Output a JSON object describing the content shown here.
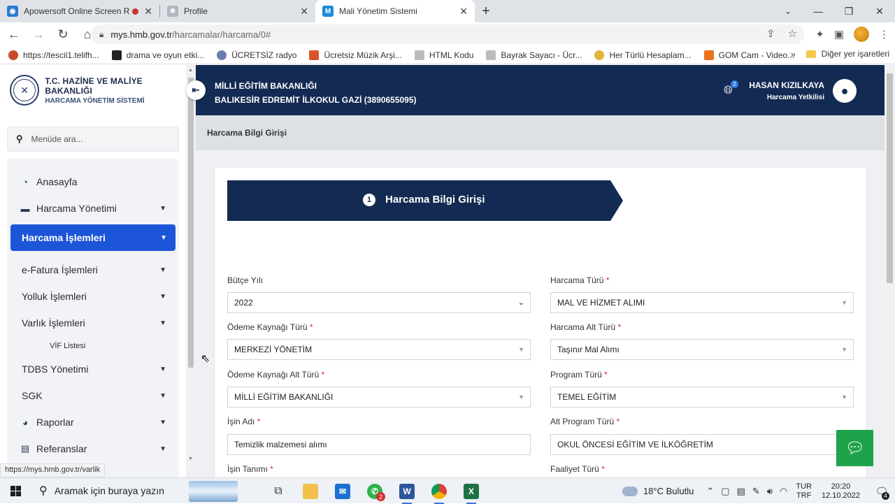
{
  "browser": {
    "tabs": [
      {
        "title": "Apowersoft Online Screen Re",
        "icon": "apowersoft-icon",
        "active": false
      },
      {
        "title": "Profile",
        "icon": "profile-icon",
        "active": false
      },
      {
        "title": "Mali Yönetim Sistemi",
        "icon": "mys-icon",
        "active": true
      }
    ],
    "url_host": "mys.hmb.gov.tr",
    "url_path": "/harcamalar/harcama/0#",
    "bookmarks": [
      "https://tescil1.telifh...",
      "drama ve oyun etki...",
      "ÜCRETSİZ radyo",
      "Ücretsiz Müzik Arşi...",
      "HTML Kodu",
      "Bayrak Sayacı - Ücr...",
      "Her Türlü Hesaplam...",
      "GOM Cam - Video..."
    ],
    "other_bookmarks": "Diğer yer işaretleri",
    "status_url": "https://mys.hmb.gov.tr/varlik"
  },
  "sidebar": {
    "logo_line1": "T.C. HAZİNE VE MALİYE BAKANLIĞI",
    "logo_line2": "HARCAMA YÖNETİM SİSTEMİ",
    "search_placeholder": "Menüde ara...",
    "items": [
      {
        "label": "Anasayfa",
        "icon": "dashboard-icon"
      },
      {
        "label": "Harcama Yönetimi",
        "icon": "card-icon"
      },
      {
        "label": "Harcama İşlemleri",
        "active": true
      },
      {
        "label": "e-Fatura İşlemleri"
      },
      {
        "label": "Yolluk İşlemleri"
      },
      {
        "label": "Varlık İşlemleri"
      },
      {
        "label": "VİF Listesi"
      },
      {
        "label": "TDBS Yönetimi"
      },
      {
        "label": "SGK"
      },
      {
        "label": "Raporlar",
        "icon": "pie-chart-icon"
      },
      {
        "label": "Referanslar",
        "icon": "book-icon"
      }
    ]
  },
  "header": {
    "org_line1": "MİLLİ EĞİTİM BAKANLIĞI",
    "org_line2": "BALIKESİR EDREMİT İLKOKUL GAZİ (3890655095)",
    "notification_count": "2",
    "user_name": "HASAN KIZILKAYA",
    "user_role": "Harcama Yetkilisi"
  },
  "page": {
    "breadcrumb": "Harcama Bilgi Girişi",
    "step_number": "1",
    "step_title": "Harcama Bilgi Girişi"
  },
  "form": {
    "butce_yili": {
      "label": "Bütçe Yılı",
      "value": "2022"
    },
    "harcama_turu": {
      "label": "Harcama Türü",
      "value": "MAL VE HİZMET ALIMI"
    },
    "odeme_kaynagi_turu": {
      "label": "Ödeme Kaynağı Türü",
      "value": "MERKEZİ YÖNETİM"
    },
    "harcama_alt_turu": {
      "label": "Harcama Alt Türü",
      "value": "Taşınır Mal Alımı"
    },
    "odeme_kaynagi_alt_turu": {
      "label": "Ödeme Kaynağı Alt Türü",
      "value": "MİLLİ EĞİTİM BAKANLIĞI"
    },
    "program_turu": {
      "label": "Program Türü",
      "value": "TEMEL EĞİTİM"
    },
    "isin_adi": {
      "label": "İşin Adı",
      "value": "Temizlik malzemesi alımı"
    },
    "alt_program_turu": {
      "label": "Alt Program Türü",
      "value": "OKUL ÖNCESİ EĞİTİM VE İLKÖĞRETİM"
    },
    "isin_tanimi": {
      "label": "İşin Tanımı"
    },
    "faaliyet_turu": {
      "label": "Faaliyet Türü"
    },
    "required_mark": "*"
  },
  "taskbar": {
    "search_placeholder": "Aramak için buraya yazın",
    "weather": "18°C  Bulutlu",
    "lang1": "TUR",
    "lang2": "TRF",
    "time": "20:20",
    "date": "12.10.2022",
    "notif_count": "4",
    "whatsapp_badge": "2"
  },
  "colors": {
    "navy": "#132a52",
    "active_blue": "#1d55d8",
    "chat_green": "#1fa34a"
  }
}
